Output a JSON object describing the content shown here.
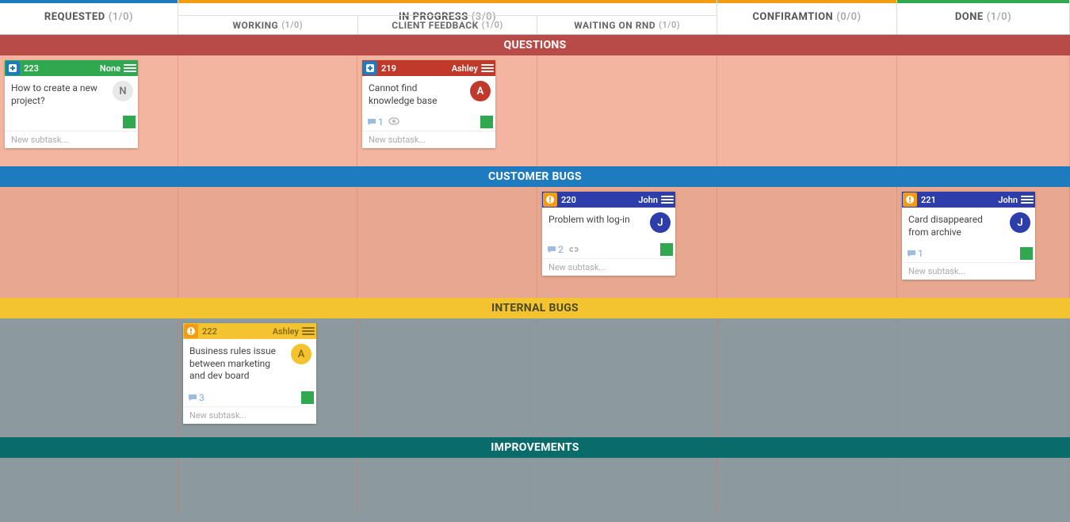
{
  "columns": {
    "requested": {
      "label": "REQUESTED",
      "count": "(1/0)",
      "accent": "#1f7bbf"
    },
    "inprogress": {
      "label": "IN PROGRESS",
      "count": "(3/0)",
      "accent": "#f39c12",
      "subs": [
        {
          "label": "WORKING",
          "count": "(1/0)"
        },
        {
          "label": "CLIENT FEEDBACK",
          "count": "(1/0)"
        },
        {
          "label": "WAITING ON RND",
          "count": "(1/0)"
        }
      ]
    },
    "confirm": {
      "label": "CONFIRAMTION",
      "count": "(0/0)",
      "accent": "#f39c12"
    },
    "done": {
      "label": "DONE",
      "count": "(1/0)",
      "accent": "#2fa84f"
    }
  },
  "swimlanes": {
    "questions": {
      "label": "QUESTIONS"
    },
    "customer": {
      "label": "CUSTOMER BUGS"
    },
    "internal": {
      "label": "INTERNAL BUGS"
    },
    "improve": {
      "label": "IMPROVEMENTS"
    }
  },
  "cards": {
    "c223": {
      "id": "223",
      "assignee": "None",
      "title": "How to create a new project?",
      "avatar": "N",
      "comments": null,
      "newsub": "New subtask..."
    },
    "c219": {
      "id": "219",
      "assignee": "Ashley",
      "title": "Cannot find knowledge base",
      "avatar": "A",
      "comments": "1",
      "watch": true,
      "newsub": "New subtask..."
    },
    "c220": {
      "id": "220",
      "assignee": "John",
      "title": "Problem with log-in",
      "avatar": "J",
      "comments": "2",
      "link": true,
      "newsub": "New subtask..."
    },
    "c221": {
      "id": "221",
      "assignee": "John",
      "title": "Card disappeared from archive",
      "avatar": "J",
      "comments": "1",
      "newsub": "New subtask..."
    },
    "c222": {
      "id": "222",
      "assignee": "Ashley",
      "title": "Business rules issue between marketing and dev board",
      "avatar": "A",
      "comments": "3",
      "newsub": "New subtask..."
    }
  }
}
